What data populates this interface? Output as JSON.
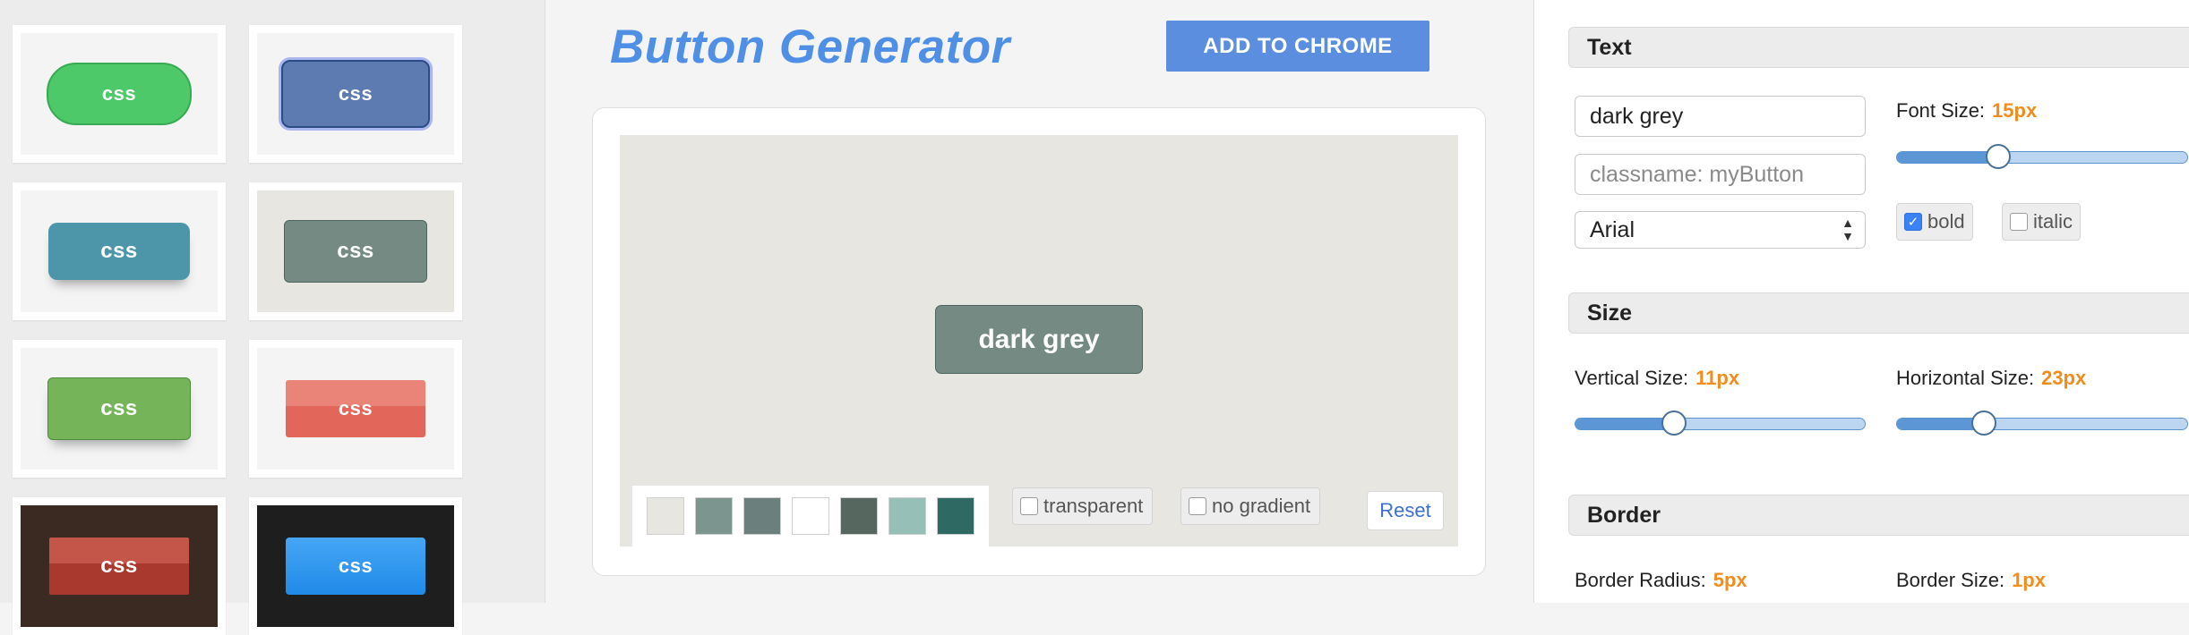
{
  "gallery": {
    "tiles": [
      {
        "label": "css"
      },
      {
        "label": "css"
      },
      {
        "label": "css"
      },
      {
        "label": "css"
      },
      {
        "label": "css"
      },
      {
        "label": "css"
      },
      {
        "label": "css"
      },
      {
        "label": "css"
      }
    ]
  },
  "header": {
    "title": "Button Generator",
    "chrome_button": "ADD TO CHROME"
  },
  "preview": {
    "button_text": "dark grey",
    "swatches": [
      "#e8e6e1",
      "#7c958e",
      "#6b7f7d",
      "#ffffff",
      "#55675f",
      "#96bfb8",
      "#2e6a63"
    ],
    "transparent_label": "transparent",
    "transparent_checked": false,
    "no_gradient_label": "no gradient",
    "no_gradient_checked": false,
    "reset_label": "Reset"
  },
  "panel": {
    "text_section": {
      "title": "Text",
      "text_value": "dark grey",
      "classname_placeholder": "classname: myButton",
      "font_select": "Arial",
      "font_size_label": "Font Size:",
      "font_size_value": "15px",
      "font_size_fraction": 0.35,
      "bold_label": "bold",
      "bold_checked": true,
      "italic_label": "italic",
      "italic_checked": false
    },
    "size_section": {
      "title": "Size",
      "vertical_label": "Vertical Size:",
      "vertical_value": "11px",
      "vertical_fraction": 0.34,
      "horizontal_label": "Horizontal Size:",
      "horizontal_value": "23px",
      "horizontal_fraction": 0.3
    },
    "border_section": {
      "title": "Border",
      "radius_label": "Border Radius:",
      "radius_value": "5px",
      "size_label": "Border Size:",
      "size_value": "1px"
    }
  },
  "colors": {
    "title_blue": "#4f8fe6",
    "chrome_button": "#5b8ede",
    "value_orange": "#f28c1c",
    "preview_button": "#748a82"
  }
}
